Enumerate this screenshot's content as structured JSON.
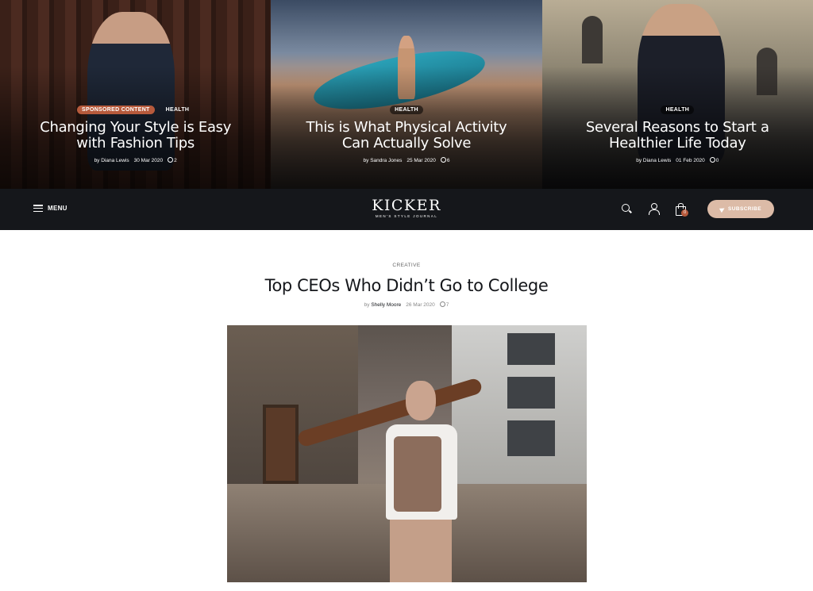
{
  "featured": [
    {
      "tags": [
        "SPONSORED CONTENT",
        "HEALTH"
      ],
      "title": "Changing Your Style is Easy with Fashion Tips",
      "author": "by Diana Lewis",
      "date": "30 Mar 2020",
      "comments": "2"
    },
    {
      "tags": [
        "HEALTH"
      ],
      "title": "This is What Physical Activity Can Actually Solve",
      "author": "by Sandra Jones",
      "date": "25 Mar 2020",
      "comments": "6"
    },
    {
      "tags": [
        "HEALTH"
      ],
      "title": "Several Reasons to Start a Healthier Life Today",
      "author": "by Diana Lewis",
      "date": "01 Feb 2020",
      "comments": "0"
    }
  ],
  "header": {
    "menu_label": "MENU",
    "logo": "KICKER",
    "logo_tagline": "MEN'S STYLE JOURNAL",
    "cart_count": "0",
    "subscribe_label": "SUBSCRIBE"
  },
  "article": {
    "category": "CREATIVE",
    "title": "Top CEOs Who Didn’t Go to College",
    "by": "by",
    "author": "Shelly Moore",
    "date": "26 Mar 2020",
    "comments": "7"
  },
  "colors": {
    "accent": "#b65a3c",
    "header_bg": "#15171b",
    "subscribe_bg": "#dcbba7"
  }
}
